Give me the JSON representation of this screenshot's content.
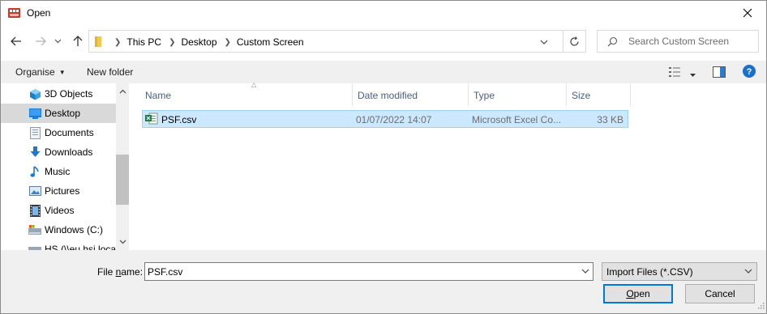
{
  "window": {
    "title": "Open"
  },
  "address": {
    "crumbs": [
      "This PC",
      "Desktop",
      "Custom Screen"
    ]
  },
  "search": {
    "placeholder": "Search Custom Screen"
  },
  "commandbar": {
    "organise": "Organise",
    "new_folder": "New folder"
  },
  "nav": {
    "items": [
      {
        "label": "3D Objects",
        "icon": "3d-objects-icon"
      },
      {
        "label": "Desktop",
        "icon": "desktop-icon",
        "selected": true
      },
      {
        "label": "Documents",
        "icon": "documents-icon"
      },
      {
        "label": "Downloads",
        "icon": "downloads-icon"
      },
      {
        "label": "Music",
        "icon": "music-icon"
      },
      {
        "label": "Pictures",
        "icon": "pictures-icon"
      },
      {
        "label": "Videos",
        "icon": "videos-icon"
      },
      {
        "label": "Windows (C:)",
        "icon": "drive-icon"
      },
      {
        "label": "HS (\\\\eu.hsi.loca",
        "icon": "network-drive-icon"
      }
    ]
  },
  "columns": {
    "name": "Name",
    "date": "Date modified",
    "type": "Type",
    "size": "Size"
  },
  "files": [
    {
      "name": "PSF.csv",
      "date": "01/07/2022 14:07",
      "type": "Microsoft Excel Co...",
      "size": "33 KB",
      "selected": true
    }
  ],
  "bottom": {
    "filename_label_pre": "File ",
    "filename_label_ul": "n",
    "filename_label_post": "ame:",
    "filename_value": "PSF.csv",
    "filter": "Import Files (*.CSV)",
    "open_ul": "O",
    "open_rest": "pen",
    "cancel": "Cancel"
  },
  "colors": {
    "selection": "#cce8ff",
    "selection_border": "#99d1ff",
    "accent": "#0078d7"
  }
}
